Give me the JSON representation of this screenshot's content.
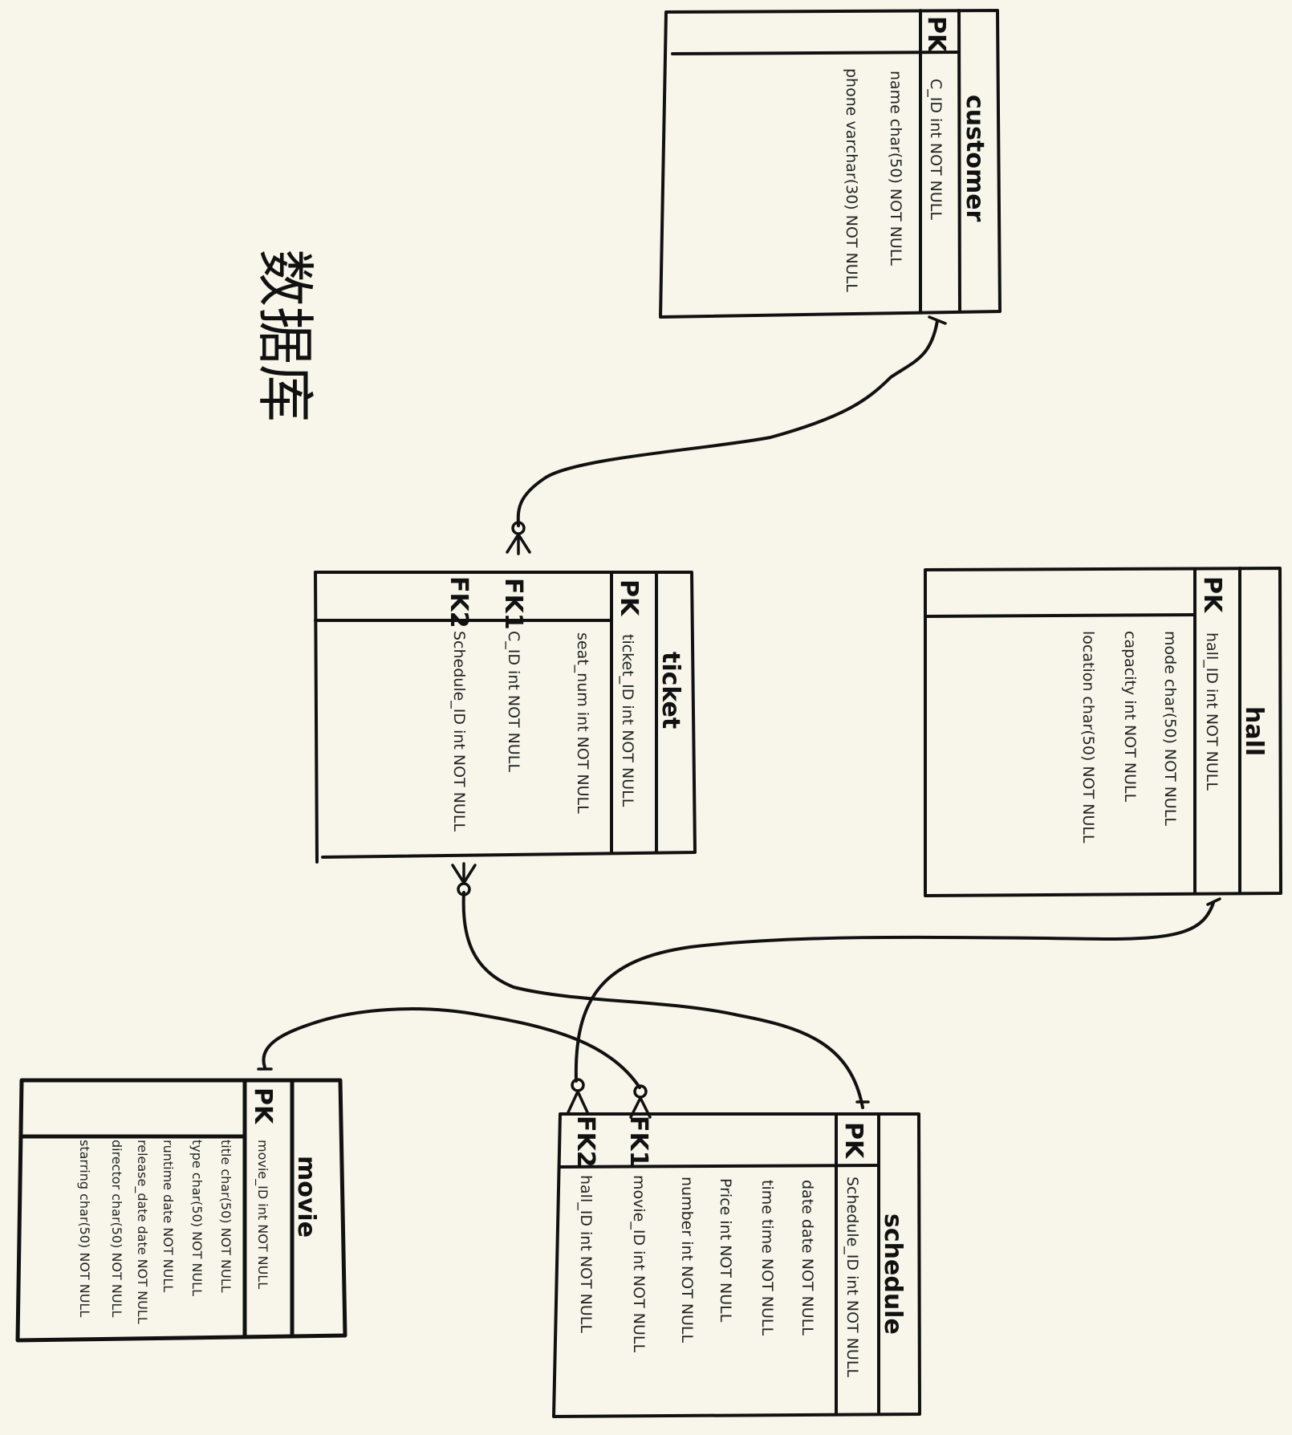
{
  "diagram": {
    "note": "数据库",
    "tables": {
      "customer": {
        "name": "customer",
        "pk_label": "PK",
        "fields": [
          "C_ID  int   NOT NULL",
          "name char(50) NOT NULL",
          "phone varchar(30) NOT NULL"
        ]
      },
      "ticket": {
        "name": "ticket",
        "pk_label": "PK",
        "fk1_label": "FK1",
        "fk2_label": "FK2",
        "fields": [
          "ticket_ID int NOT NULL",
          "seat_num  int NOT NULL",
          "C_ID   int    NOT NULL",
          "Schedule_ID  int NOT NULL"
        ]
      },
      "hall": {
        "name": "hall",
        "pk_label": "PK",
        "fields": [
          "hall_ID   int    NOT NULL",
          "mode   char(50)   NOT NULL",
          "capacity   int      NOT NULL",
          "location   char(50)   NOT NULL"
        ]
      },
      "movie": {
        "name": "movie",
        "pk_label": "PK",
        "fields": [
          "movie_ID  int NOT NULL",
          "title  char(50) NOT NULL",
          "type  char(50) NOT NULL",
          "runtime  date   NOT NULL",
          "release_date  date  NOT NULL",
          "director  char(50)  NOT NULL",
          "starring  char(50) NOT NULL"
        ]
      },
      "schedule": {
        "name": "schedule",
        "pk_label": "PK",
        "fk1_label": "FK1",
        "fk2_label": "FK2",
        "fields": [
          "Schedule_ID  int  NOT NULL",
          "date   date    NOT NULL",
          "time   time    NOT NULL",
          "Price   int      NOT   NULL",
          "number   int      NOT   NULL",
          "movie_ID  int  NOT NULL",
          "hall_ID   int       NOT   NULL"
        ]
      }
    },
    "relationships": [
      {
        "from": "customer",
        "to": "ticket",
        "from_end": "one",
        "to_end": "zero-or-many"
      },
      {
        "from": "schedule",
        "to": "ticket",
        "from_end": "one",
        "to_end": "zero-or-many"
      },
      {
        "from": "hall",
        "to": "schedule",
        "from_end": "one",
        "to_end": "zero-or-many"
      },
      {
        "from": "movie",
        "to": "schedule",
        "from_end": "one",
        "to_end": "zero-or-many"
      }
    ]
  }
}
